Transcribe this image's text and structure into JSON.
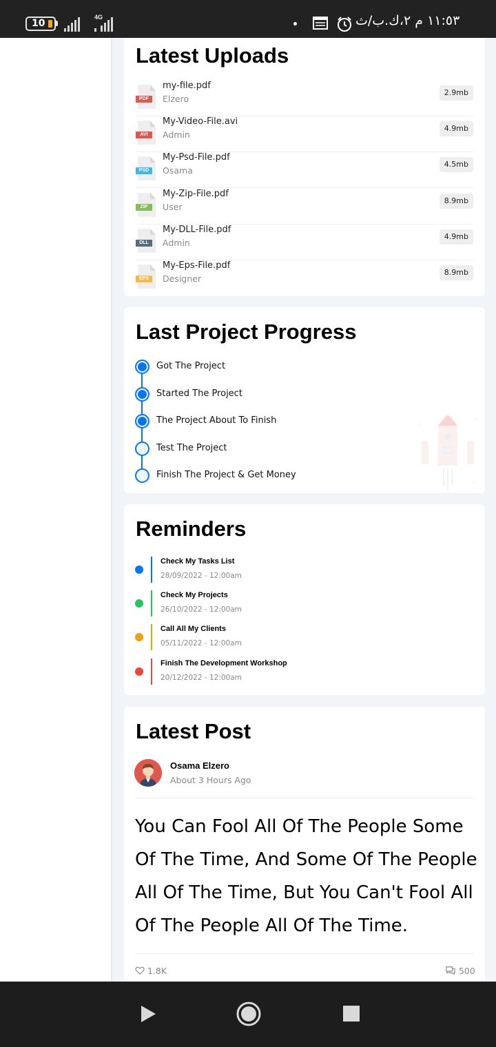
{
  "status_bar": {
    "battery": "10",
    "network": "4G",
    "clock": "١١:٥٣ م ٢،ك.ب/ث",
    "icons": [
      "battery-icon",
      "signal-icon",
      "signal-4g-icon",
      "dot-icon",
      "news-icon",
      "alarm-icon"
    ]
  },
  "latest_uploads": {
    "title": "Latest Uploads",
    "files": [
      {
        "name": "my-file.pdf",
        "owner": "Elzero",
        "size": "2.9mb",
        "type": "PDF",
        "color": "#e2574c"
      },
      {
        "name": "My-Video-File.avi",
        "owner": "Admin",
        "size": "4.9mb",
        "type": "AVI",
        "color": "#e2574c"
      },
      {
        "name": "My-Psd-File.pdf",
        "owner": "Osama",
        "size": "4.5mb",
        "type": "PSD",
        "color": "#3db9e8"
      },
      {
        "name": "My-Zip-File.pdf",
        "owner": "User",
        "size": "8.9mb",
        "type": "ZIP",
        "color": "#84bd5a"
      },
      {
        "name": "My-DLL-File.pdf",
        "owner": "Admin",
        "size": "4.9mb",
        "type": "DLL",
        "color": "#576d7e"
      },
      {
        "name": "My-Eps-File.pdf",
        "owner": "Designer",
        "size": "8.9mb",
        "type": "EPS",
        "color": "#f7b84e"
      }
    ]
  },
  "project_progress": {
    "title": "Last Project Progress",
    "steps": [
      {
        "label": "Got The Project",
        "done": true
      },
      {
        "label": "Started The Project",
        "done": true
      },
      {
        "label": "The Project About To Finish",
        "done": true
      },
      {
        "label": "Test The Project",
        "done": false
      },
      {
        "label": "Finish The Project & Get Money",
        "done": false
      }
    ],
    "accent": "#0075ff"
  },
  "reminders": {
    "title": "Reminders",
    "items": [
      {
        "title": "Check My Tasks List",
        "date": "28/09/2022 - 12:00am",
        "color": "#0075ff"
      },
      {
        "title": "Check My Projects",
        "date": "26/10/2022 - 12:00am",
        "color": "#22c55e"
      },
      {
        "title": "Call All My Clients",
        "date": "05/11/2022 - 12:00am",
        "color": "#f59e0b"
      },
      {
        "title": "Finish The Development Workshop",
        "date": "20/12/2022 - 12:00am",
        "color": "#f44336"
      }
    ]
  },
  "latest_post": {
    "title": "Latest Post",
    "author": "Osama Elzero",
    "time": "About 3 Hours Ago",
    "text": "You Can Fool All Of The People Some Of The Time, And Some Of The People All Of The Time, But You Can't Fool All Of The People All Of The Time.",
    "likes": "1.8K",
    "comments": "500"
  },
  "nav_bar": {
    "icons": [
      "back-triangle-icon",
      "home-circle-icon",
      "recents-square-icon"
    ]
  }
}
